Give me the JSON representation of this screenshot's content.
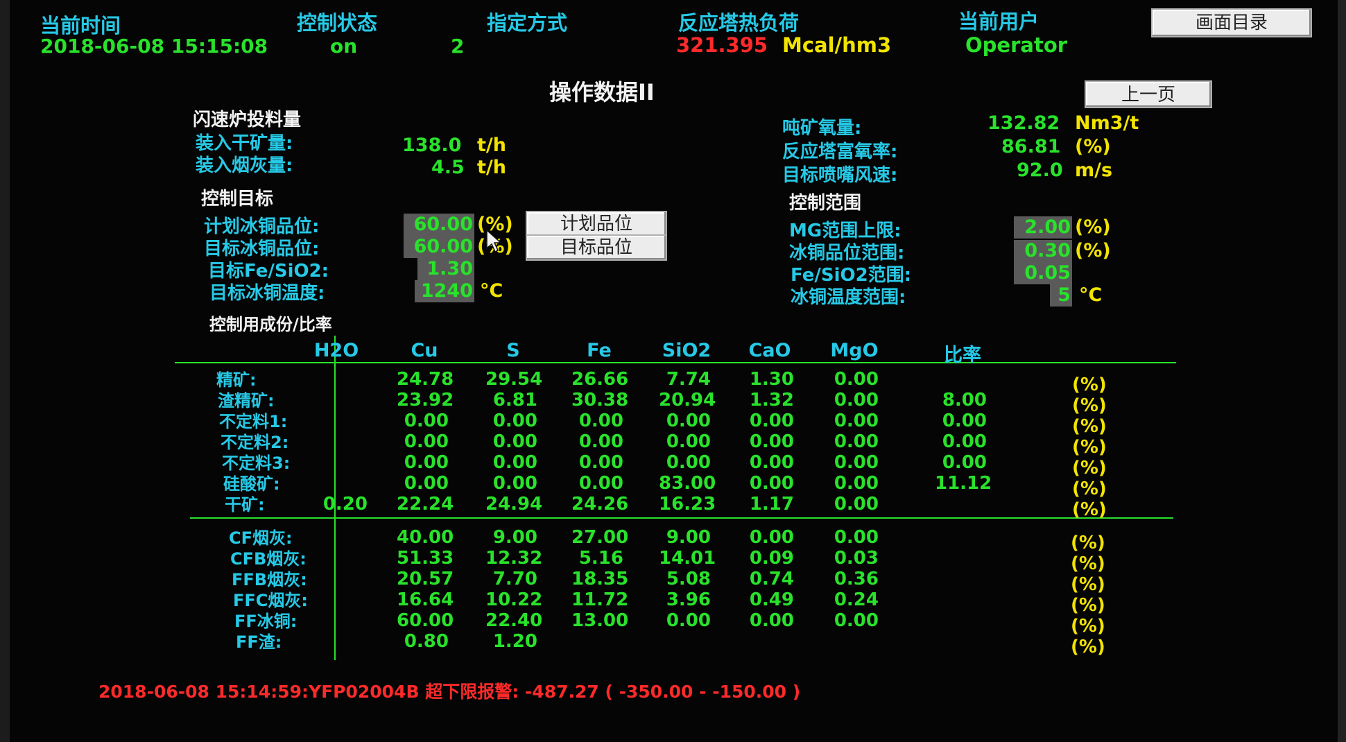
{
  "header": {
    "time_label": "当前时间",
    "time_value": "2018-06-08 15:15:08",
    "control_state_label": "控制状态",
    "control_state_value": "on",
    "mode_label": "指定方式",
    "mode_value": "2",
    "heat_load_label": "反应塔热负荷",
    "heat_load_value": "321.395",
    "heat_load_unit": "Mcal/hm3",
    "user_label": "当前用户",
    "user_value": "Operator",
    "menu_button": "画面目录"
  },
  "page_title": "操作数据II",
  "prev_button": "上一页",
  "feed": {
    "title": "闪速炉投料量",
    "dry_ore_label": "装入干矿量:",
    "dry_ore_value": "138.0",
    "dry_ore_unit": "t/h",
    "dust_label": "装入烟灰量:",
    "dust_value": "4.5",
    "dust_unit": "t/h"
  },
  "oxygen": {
    "per_ton_label": "吨矿氧量:",
    "per_ton_value": "132.82",
    "per_ton_unit": "Nm3/t",
    "enrich_label": "反应塔富氧率:",
    "enrich_value": "86.81",
    "enrich_unit": "(%)",
    "nozzle_label": "目标喷嘴风速:",
    "nozzle_value": "92.0",
    "nozzle_unit": "m/s"
  },
  "targets": {
    "title": "控制目标",
    "plan_grade_label": "计划冰铜品位:",
    "plan_grade_value": "60.00",
    "plan_grade_unit": "(%)",
    "target_grade_label": "目标冰铜品位:",
    "target_grade_value": "60.00",
    "target_grade_unit": "(%)",
    "fe_sio2_label": "目标Fe/SiO2:",
    "fe_sio2_value": "1.30",
    "temp_label": "目标冰铜温度:",
    "temp_value": "1240",
    "temp_unit": "°C",
    "plan_grade_button": "计划品位",
    "target_grade_button": "目标品位"
  },
  "ranges": {
    "title": "控制范围",
    "mg_label": "MG范围上限:",
    "mg_value": "2.00",
    "mg_unit": "(%)",
    "grade_label": "冰铜品位范围:",
    "grade_value": "0.30",
    "grade_unit": "(%)",
    "fe_label": "Fe/SiO2范围:",
    "fe_value": "0.05",
    "temp_label": "冰铜温度范围:",
    "temp_value": "5",
    "temp_unit": "°C"
  },
  "composition": {
    "title": "控制用成份/比率",
    "columns": [
      "H2O",
      "Cu",
      "S",
      "Fe",
      "SiO2",
      "CaO",
      "MgO",
      "比率"
    ],
    "pct_unit": "(%)",
    "group1": [
      {
        "label": "精矿:",
        "h2o": "",
        "cu": "24.78",
        "s": "29.54",
        "fe": "26.66",
        "sio2": "7.74",
        "cao": "1.30",
        "mgo": "0.00",
        "ratio": ""
      },
      {
        "label": "渣精矿:",
        "h2o": "",
        "cu": "23.92",
        "s": "6.81",
        "fe": "30.38",
        "sio2": "20.94",
        "cao": "1.32",
        "mgo": "0.00",
        "ratio": "8.00"
      },
      {
        "label": "不定料1:",
        "h2o": "",
        "cu": "0.00",
        "s": "0.00",
        "fe": "0.00",
        "sio2": "0.00",
        "cao": "0.00",
        "mgo": "0.00",
        "ratio": "0.00"
      },
      {
        "label": "不定料2:",
        "h2o": "",
        "cu": "0.00",
        "s": "0.00",
        "fe": "0.00",
        "sio2": "0.00",
        "cao": "0.00",
        "mgo": "0.00",
        "ratio": "0.00"
      },
      {
        "label": "不定料3:",
        "h2o": "",
        "cu": "0.00",
        "s": "0.00",
        "fe": "0.00",
        "sio2": "0.00",
        "cao": "0.00",
        "mgo": "0.00",
        "ratio": "0.00"
      },
      {
        "label": "硅酸矿:",
        "h2o": "",
        "cu": "0.00",
        "s": "0.00",
        "fe": "0.00",
        "sio2": "83.00",
        "cao": "0.00",
        "mgo": "0.00",
        "ratio": "11.12"
      },
      {
        "label": "干矿:",
        "h2o": "0.20",
        "cu": "22.24",
        "s": "24.94",
        "fe": "24.26",
        "sio2": "16.23",
        "cao": "1.17",
        "mgo": "0.00",
        "ratio": ""
      }
    ],
    "group2": [
      {
        "label": "CF烟灰:",
        "cu": "40.00",
        "s": "9.00",
        "fe": "27.00",
        "sio2": "9.00",
        "cao": "0.00",
        "mgo": "0.00"
      },
      {
        "label": "CFB烟灰:",
        "cu": "51.33",
        "s": "12.32",
        "fe": "5.16",
        "sio2": "14.01",
        "cao": "0.09",
        "mgo": "0.03"
      },
      {
        "label": "FFB烟灰:",
        "cu": "20.57",
        "s": "7.70",
        "fe": "18.35",
        "sio2": "5.08",
        "cao": "0.74",
        "mgo": "0.36"
      },
      {
        "label": "FFC烟灰:",
        "cu": "16.64",
        "s": "10.22",
        "fe": "11.72",
        "sio2": "3.96",
        "cao": "0.49",
        "mgo": "0.24"
      },
      {
        "label": "FF冰铜:",
        "cu": "60.00",
        "s": "22.40",
        "fe": "13.00",
        "sio2": "0.00",
        "cao": "0.00",
        "mgo": "0.00"
      },
      {
        "label": "FF渣:",
        "cu": "0.80",
        "s": "1.20",
        "fe": "",
        "sio2": "",
        "cao": "",
        "mgo": ""
      }
    ]
  },
  "alarm": "2018-06-08 15:14:59:YFP02004B 超下限报警:  -487.27 ( -350.00 - -150.00 )"
}
